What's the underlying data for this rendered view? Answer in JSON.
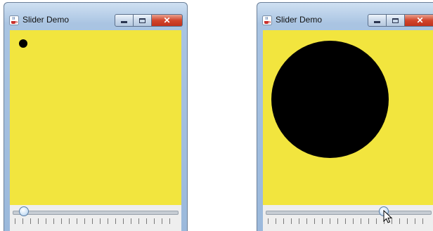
{
  "windows": [
    {
      "title": "Slider Demo",
      "icon": "java-coffee-cup-icon",
      "canvas_color": "#f2e53e",
      "dot_color": "#000000",
      "slider_value_fraction": 0.04
    },
    {
      "title": "Slider Demo",
      "icon": "java-coffee-cup-icon",
      "canvas_color": "#f2e53e",
      "dot_color": "#000000",
      "slider_value_fraction": 0.72
    }
  ],
  "caption_buttons": {
    "minimize": "minimize-icon",
    "maximize": "maximize-icon",
    "close": "close-icon"
  },
  "colors": {
    "canvas": "#f2e53e",
    "dot": "#000000",
    "close_button": "#d2452c"
  }
}
